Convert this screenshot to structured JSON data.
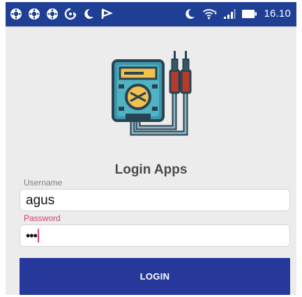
{
  "status_bar": {
    "left_icons": [
      "notification-icon",
      "notification-icon",
      "notification-icon",
      "sync-icon",
      "moon-icon",
      "flag-icon"
    ],
    "right_icons": [
      "moon-icon",
      "wifi-icon",
      "signal-icon",
      "battery-icon"
    ],
    "time": "16.10",
    "background_color": "#1f3f95"
  },
  "app": {
    "logo_icon": "multimeter-icon",
    "title": "Login Apps"
  },
  "form": {
    "username": {
      "label": "Username",
      "value": "agus"
    },
    "password": {
      "label": "Password",
      "masked_value": "•••"
    },
    "login_button_label": "LOGIN"
  },
  "colors": {
    "primary": "#26399a",
    "accent": "#e4417b",
    "background": "#ececec"
  }
}
